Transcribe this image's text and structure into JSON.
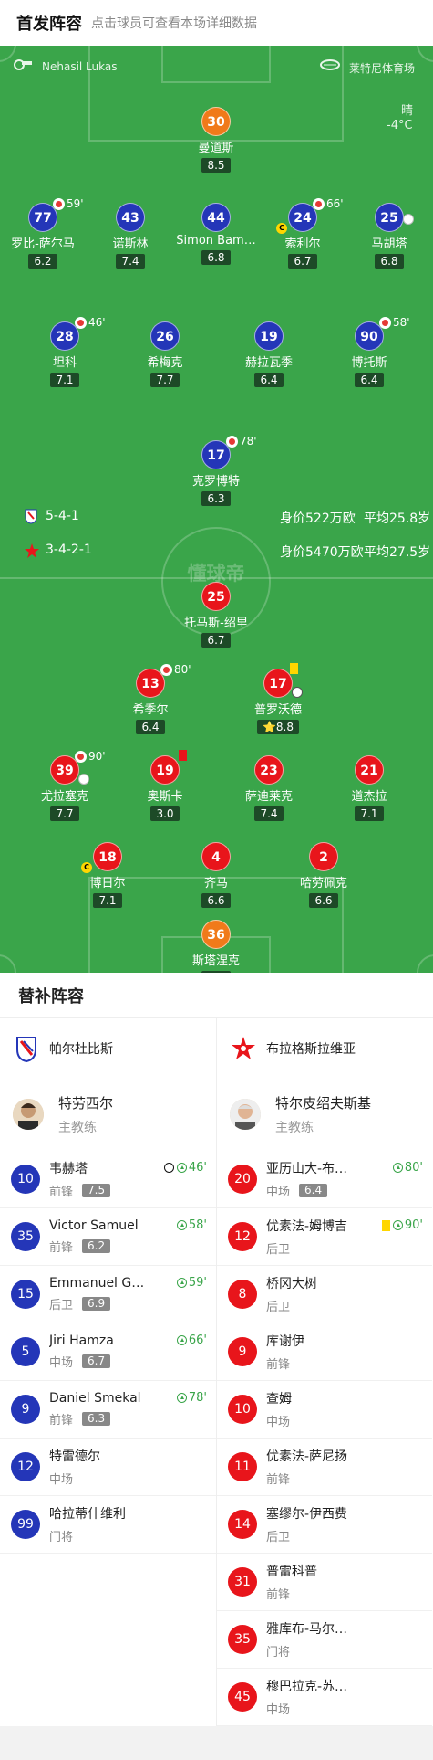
{
  "header": {
    "title": "首发阵容",
    "subtitle": "点击球员可查看本场详细数据"
  },
  "pitch_info": {
    "referee": "Nehasil Lukas",
    "stadium": "莱特尼体育场",
    "weather": "晴",
    "temperature": "-4°C",
    "watermark": "懂球帝"
  },
  "home": {
    "formation": "5-4-1",
    "value": "身价522万欧",
    "age": "平均25.8岁"
  },
  "away": {
    "formation": "3-4-2-1",
    "value": "身价5470万欧",
    "age": "平均27.5岁"
  },
  "home_players": [
    {
      "num": "30",
      "name": "曼道斯",
      "rating": "8.5",
      "color": "o"
    },
    {
      "num": "77",
      "name": "罗比-萨尔马",
      "rating": "6.2",
      "color": "b",
      "sub": "59'"
    },
    {
      "num": "43",
      "name": "诺斯林",
      "rating": "7.4",
      "color": "b"
    },
    {
      "num": "44",
      "name": "Simon Bam…",
      "rating": "6.8",
      "color": "b"
    },
    {
      "num": "24",
      "name": "索利尔",
      "rating": "6.7",
      "color": "b",
      "sub": "66'",
      "cap": "C"
    },
    {
      "num": "25",
      "name": "马胡塔",
      "rating": "6.8",
      "color": "b"
    },
    {
      "num": "28",
      "name": "坦科",
      "rating": "7.1",
      "color": "b",
      "sub": "46'"
    },
    {
      "num": "26",
      "name": "希梅克",
      "rating": "7.7",
      "color": "b"
    },
    {
      "num": "19",
      "name": "赫拉瓦季",
      "rating": "6.4",
      "color": "b"
    },
    {
      "num": "90",
      "name": "博托斯",
      "rating": "6.4",
      "color": "b",
      "sub": "58'"
    },
    {
      "num": "17",
      "name": "克罗博特",
      "rating": "6.3",
      "color": "b",
      "sub": "78'"
    }
  ],
  "away_players": [
    {
      "num": "25",
      "name": "托马斯-绍里",
      "rating": "6.7",
      "color": "r"
    },
    {
      "num": "13",
      "name": "希季尔",
      "rating": "6.4",
      "color": "r",
      "sub": "80'"
    },
    {
      "num": "17",
      "name": "普罗沃德",
      "rating": "8.8",
      "color": "r"
    },
    {
      "num": "39",
      "name": "尤拉塞克",
      "rating": "7.7",
      "color": "r",
      "sub": "90'"
    },
    {
      "num": "19",
      "name": "奥斯卡",
      "rating": "3.0",
      "color": "r"
    },
    {
      "num": "23",
      "name": "萨迪莱克",
      "rating": "7.4",
      "color": "r"
    },
    {
      "num": "21",
      "name": "道杰拉",
      "rating": "7.1",
      "color": "r"
    },
    {
      "num": "18",
      "name": "博日尔",
      "rating": "7.1",
      "color": "r",
      "cap": "C"
    },
    {
      "num": "4",
      "name": "齐马",
      "rating": "6.6",
      "color": "r"
    },
    {
      "num": "2",
      "name": "哈劳佩克",
      "rating": "6.6",
      "color": "r"
    },
    {
      "num": "36",
      "name": "斯塔涅克",
      "rating": "8.3",
      "color": "o"
    }
  ],
  "subs_title": "替补阵容",
  "home_team": {
    "name": "帕尔杜比斯",
    "coach": "特劳西尔",
    "coach_role": "主教练"
  },
  "away_team": {
    "name": "布拉格斯拉维亚",
    "coach": "特尔皮绍夫斯基",
    "coach_role": "主教练"
  },
  "home_subs": [
    {
      "num": "10",
      "name": "韦赫塔",
      "pos": "前锋",
      "rating": "7.5",
      "in": "46'"
    },
    {
      "num": "35",
      "name": "Victor Samuel",
      "pos": "前锋",
      "rating": "6.2",
      "in": "58'"
    },
    {
      "num": "15",
      "name": "Emmanuel G…",
      "pos": "后卫",
      "rating": "6.9",
      "in": "59'"
    },
    {
      "num": "5",
      "name": "Jiri Hamza",
      "pos": "中场",
      "rating": "6.7",
      "in": "66'"
    },
    {
      "num": "9",
      "name": "Daniel Smekal",
      "pos": "前锋",
      "rating": "6.3",
      "in": "78'"
    },
    {
      "num": "12",
      "name": "特雷德尔",
      "pos": "中场"
    },
    {
      "num": "99",
      "name": "哈拉蒂什维利",
      "pos": "门将"
    }
  ],
  "away_subs": [
    {
      "num": "20",
      "name": "亚历山大-布…",
      "pos": "中场",
      "rating": "6.4",
      "in": "80'"
    },
    {
      "num": "12",
      "name": "优素法-姆博吉",
      "pos": "后卫",
      "in": "90'"
    },
    {
      "num": "8",
      "name": "桥冈大树",
      "pos": "后卫"
    },
    {
      "num": "9",
      "name": "库谢伊",
      "pos": "前锋"
    },
    {
      "num": "10",
      "name": "查姆",
      "pos": "中场"
    },
    {
      "num": "11",
      "name": "优素法-萨尼扬",
      "pos": "前锋"
    },
    {
      "num": "14",
      "name": "塞缪尔-伊西费",
      "pos": "后卫"
    },
    {
      "num": "31",
      "name": "普雷科普",
      "pos": "前锋"
    },
    {
      "num": "35",
      "name": "雅库布-马尔…",
      "pos": "门将"
    },
    {
      "num": "45",
      "name": "穆巴拉克-苏…",
      "pos": "中场"
    }
  ]
}
